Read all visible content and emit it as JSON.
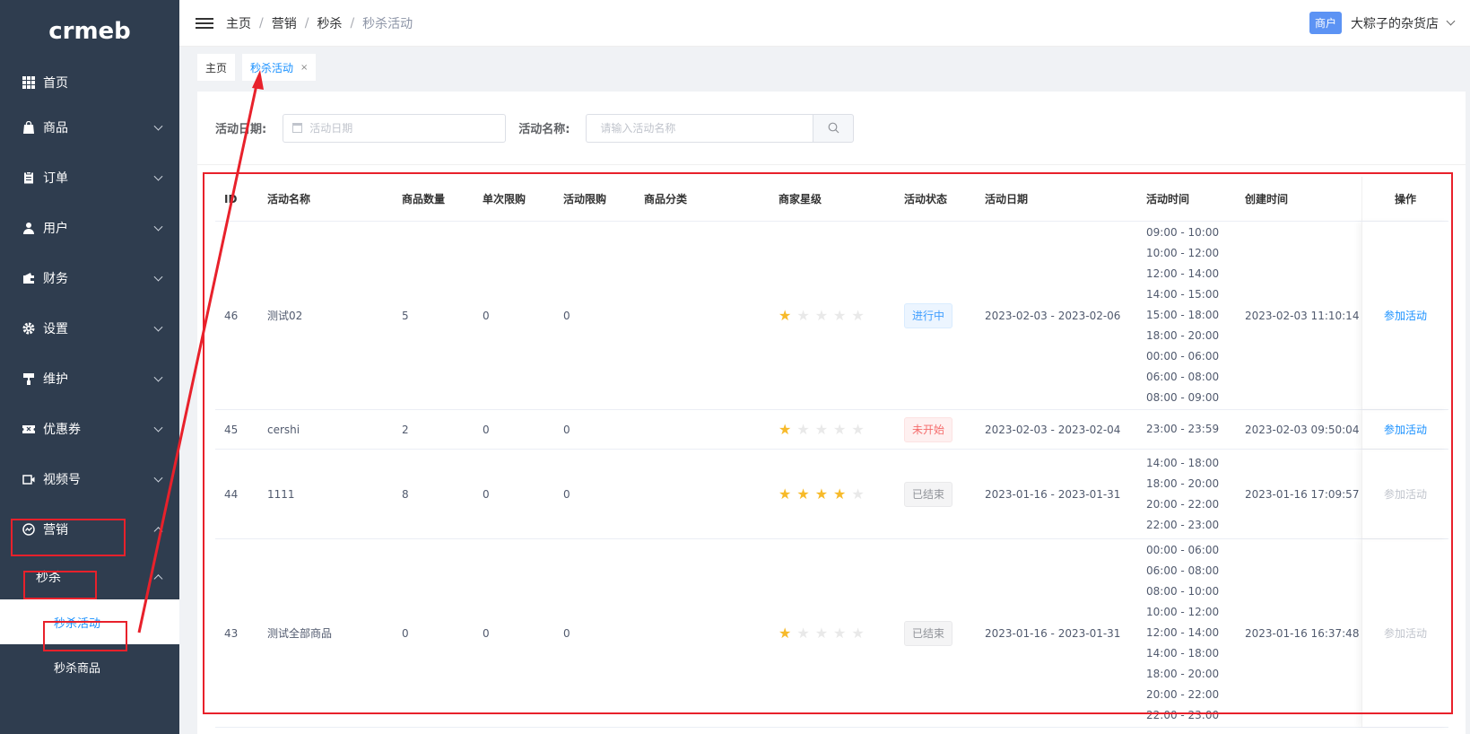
{
  "logo": "crmeb",
  "sidebar": {
    "items": [
      {
        "label": "首页",
        "icon": "grid-icon",
        "expandable": false
      },
      {
        "label": "商品",
        "icon": "bag-icon",
        "expandable": true
      },
      {
        "label": "订单",
        "icon": "clipboard-icon",
        "expandable": true
      },
      {
        "label": "用户",
        "icon": "user-icon",
        "expandable": true
      },
      {
        "label": "财务",
        "icon": "wallet-icon",
        "expandable": true
      },
      {
        "label": "设置",
        "icon": "gear-icon",
        "expandable": true
      },
      {
        "label": "维护",
        "icon": "roller-icon",
        "expandable": true
      },
      {
        "label": "优惠券",
        "icon": "ticket-icon",
        "expandable": true
      },
      {
        "label": "视频号",
        "icon": "video-icon",
        "expandable": true
      },
      {
        "label": "营销",
        "icon": "marketing-icon",
        "expandable": true,
        "expanded": true
      }
    ],
    "submenu": {
      "label": "秒杀"
    },
    "leaves": [
      {
        "label": "秒杀活动",
        "active": true
      },
      {
        "label": "秒杀商品",
        "active": false
      }
    ]
  },
  "header": {
    "breadcrumb": [
      "主页",
      "营销",
      "秒杀",
      "秒杀活动"
    ],
    "merchant_badge": "商户",
    "store_name": "大粽子的杂货店"
  },
  "tags": [
    {
      "label": "主页",
      "active": false
    },
    {
      "label": "秒杀活动",
      "active": true,
      "close": "×"
    }
  ],
  "filters": {
    "date_label": "活动日期:",
    "date_placeholder": "活动日期",
    "name_label": "活动名称:",
    "name_placeholder": "请输入活动名称"
  },
  "table": {
    "headers": {
      "id": "ID",
      "name": "活动名称",
      "count": "商品数量",
      "single": "单次限购",
      "limit": "活动限购",
      "category": "商品分类",
      "star": "商家星级",
      "status": "活动状态",
      "date": "活动日期",
      "time": "活动时间",
      "created": "创建时间",
      "op": "操作"
    },
    "rows": [
      {
        "id": "46",
        "name": "测试02",
        "count": "5",
        "single": "0",
        "limit": "0",
        "category": "",
        "stars": 1,
        "status": "进行中",
        "status_type": "progress",
        "date": "2023-02-03 - 2023-02-06",
        "times": [
          "09:00 - 10:00",
          "10:00 - 12:00",
          "12:00 - 14:00",
          "14:00 - 15:00",
          "15:00 - 18:00",
          "18:00 - 20:00",
          "00:00 - 06:00",
          "06:00 - 08:00",
          "08:00 - 09:00"
        ],
        "created": "2023-02-03 11:10:14",
        "op": "参加活动",
        "op_enabled": true
      },
      {
        "id": "45",
        "name": "cershi",
        "count": "2",
        "single": "0",
        "limit": "0",
        "category": "",
        "stars": 1,
        "status": "未开始",
        "status_type": "pending",
        "date": "2023-02-03 - 2023-02-04",
        "times": [
          "23:00 - 23:59"
        ],
        "created": "2023-02-03 09:50:04",
        "op": "参加活动",
        "op_enabled": true
      },
      {
        "id": "44",
        "name": "1111",
        "count": "8",
        "single": "0",
        "limit": "0",
        "category": "",
        "stars": 4,
        "status": "已结束",
        "status_type": "ended",
        "date": "2023-01-16 - 2023-01-31",
        "times": [
          "14:00 - 18:00",
          "18:00 - 20:00",
          "20:00 - 22:00",
          "22:00 - 23:00"
        ],
        "created": "2023-01-16 17:09:57",
        "op": "参加活动",
        "op_enabled": false
      },
      {
        "id": "43",
        "name": "测试全部商品",
        "count": "0",
        "single": "0",
        "limit": "0",
        "category": "",
        "stars": 1,
        "status": "已结束",
        "status_type": "ended",
        "date": "2023-01-16 - 2023-01-31",
        "times": [
          "00:00 - 06:00",
          "06:00 - 08:00",
          "08:00 - 10:00",
          "10:00 - 12:00",
          "12:00 - 14:00",
          "14:00 - 18:00",
          "18:00 - 20:00",
          "20:00 - 22:00",
          "22:00 - 23:00"
        ],
        "created": "2023-01-16 16:37:48",
        "op": "参加活动",
        "op_enabled": false
      }
    ]
  },
  "colors": {
    "sidebar_bg": "#2f3d4f",
    "accent": "#1890ff",
    "annotation_red": "#e8212b",
    "star_on": "#f7ba2a"
  }
}
